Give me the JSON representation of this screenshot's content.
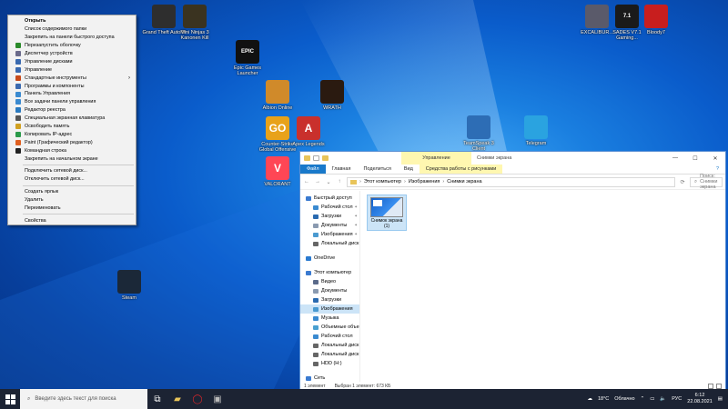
{
  "desktop_icons": [
    {
      "label": "Grand Theft Auto V",
      "icon": "gta-icon",
      "color": "#2e2e2e"
    },
    {
      "label": "Mini Ninjas 3 Kanonen Kill",
      "icon": "game-icon",
      "color": "#3a3320"
    },
    {
      "label": "Epic Games Launcher",
      "icon": "epic-icon",
      "color": "#111111",
      "glyph": "EPIC"
    },
    {
      "label": "Albion Online",
      "icon": "albion-icon",
      "color": "#d08a2a"
    },
    {
      "label": "WRATH",
      "icon": "wrath-icon",
      "color": "#2a1a10"
    },
    {
      "label": "Counter-Strike Global Offensive",
      "icon": "csgo-icon",
      "color": "#e8a21a",
      "glyph": "GO"
    },
    {
      "label": "Apex Legends",
      "icon": "apex-icon",
      "color": "#c9302c",
      "glyph": "A"
    },
    {
      "label": "VALORANT",
      "icon": "valorant-icon",
      "color": "#ff4655",
      "glyph": "V"
    },
    {
      "label": "TeamSpeak 3 Client",
      "icon": "teamspeak-icon",
      "color": "#2d6db5"
    },
    {
      "label": "Telegram",
      "icon": "telegram-icon",
      "color": "#2aa3e0"
    },
    {
      "label": "EXCALIBUR...",
      "icon": "excalibur-icon",
      "color": "#5a5a6a"
    },
    {
      "label": "SADES V7.1 Gaming...",
      "icon": "sades-icon",
      "color": "#1a1a1a",
      "glyph": "7.1"
    },
    {
      "label": "Bloody7",
      "icon": "bloody-icon",
      "color": "#c81e1e"
    },
    {
      "label": "Steam",
      "icon": "steam-icon",
      "color": "#1b2838"
    }
  ],
  "context_menu": {
    "items": [
      {
        "label": "Открыть",
        "bold": true,
        "color": ""
      },
      {
        "label": "Список содержимого папки",
        "color": ""
      },
      {
        "label": "Закрепить на панели быстрого доступа",
        "color": ""
      },
      {
        "label": "Перезапустить оболочку",
        "color": "#2a8a2a"
      },
      {
        "label": "Диспетчер устройств",
        "color": "#6a6a8a"
      },
      {
        "label": "Управление дисками",
        "color": "#3a6ab0"
      },
      {
        "label": "Управление",
        "color": "#3a6ab0"
      },
      {
        "label": "Стандартные инструменты",
        "color": "#c84a1a",
        "submenu": true
      },
      {
        "label": "Программы и компоненты",
        "color": "#3a6ab0"
      },
      {
        "label": "Панель Управления",
        "color": "#3a8ad0"
      },
      {
        "label": "Все задачи панели управления",
        "color": "#3a8ad0"
      },
      {
        "label": "Редактор реестра",
        "color": "#2a7ac0"
      },
      {
        "label": "Специальная экранная клавиатура",
        "color": "#555555"
      },
      {
        "label": "Освободить память",
        "color": "#d0a020"
      },
      {
        "label": "Копировать IP-адрес",
        "color": "#2a9a4a"
      },
      {
        "label": "Paint (Графический редактор)",
        "color": "#e06020"
      },
      {
        "label": "Командная строка",
        "color": "#222222"
      },
      {
        "label": "Закрепить на начальном экране",
        "color": ""
      },
      {
        "sep": true
      },
      {
        "label": "Подключить сетевой диск...",
        "color": ""
      },
      {
        "label": "Отключить сетевой диск...",
        "color": ""
      },
      {
        "sep": true
      },
      {
        "label": "Создать ярлык",
        "color": ""
      },
      {
        "label": "Удалить",
        "color": ""
      },
      {
        "label": "Переименовать",
        "color": ""
      },
      {
        "sep": true
      },
      {
        "label": "Свойства",
        "color": ""
      }
    ]
  },
  "explorer": {
    "context_tab_header": "Управление",
    "window_title": "Снимки экрана",
    "ribbon_tabs": [
      "Файл",
      "Главная",
      "Поделиться",
      "Вид",
      "Средства работы с рисунками"
    ],
    "address": [
      "Этот компьютер",
      "Изображения",
      "Снимки экрана"
    ],
    "search_placeholder": "Поиск: Снимки экрана",
    "nav": [
      {
        "label": "Быстрый доступ",
        "icon": "star-icon",
        "color": "#3a7ad0",
        "indent": 0
      },
      {
        "label": "Рабочий стол",
        "icon": "desktop-icon",
        "color": "#3a8ad0",
        "indent": 1,
        "pin": true
      },
      {
        "label": "Загрузки",
        "icon": "download-icon",
        "color": "#2a6ab0",
        "indent": 1,
        "pin": true
      },
      {
        "label": "Документы",
        "icon": "documents-icon",
        "color": "#8a9ab0",
        "indent": 1,
        "pin": true
      },
      {
        "label": "Изображения",
        "icon": "pictures-icon",
        "color": "#4a9ad0",
        "indent": 1,
        "pin": true
      },
      {
        "label": "Локальный диск (Z",
        "icon": "drive-icon",
        "color": "#666666",
        "indent": 1
      },
      {
        "gap": true
      },
      {
        "label": "OneDrive",
        "icon": "onedrive-icon",
        "color": "#2a7ad0",
        "indent": 0
      },
      {
        "gap": true
      },
      {
        "label": "Этот компьютер",
        "icon": "computer-icon",
        "color": "#3a7ad0",
        "indent": 0
      },
      {
        "label": "Видео",
        "icon": "video-icon",
        "color": "#5a6a8a",
        "indent": 1
      },
      {
        "label": "Документы",
        "icon": "documents-icon",
        "color": "#8a9ab0",
        "indent": 1
      },
      {
        "label": "Загрузки",
        "icon": "download-icon",
        "color": "#2a6ab0",
        "indent": 1
      },
      {
        "label": "Изображения",
        "icon": "pictures-icon",
        "color": "#4a9ad0",
        "indent": 1,
        "selected": true
      },
      {
        "label": "Музыка",
        "icon": "music-icon",
        "color": "#3a8ad0",
        "indent": 1
      },
      {
        "label": "Объемные объект",
        "icon": "3d-objects-icon",
        "color": "#4aa0d0",
        "indent": 1
      },
      {
        "label": "Рабочий стол",
        "icon": "desktop-icon",
        "color": "#3a8ad0",
        "indent": 1
      },
      {
        "label": "Локальный диск (С",
        "icon": "drive-icon",
        "color": "#666666",
        "indent": 1
      },
      {
        "label": "Локальный диск (D",
        "icon": "drive-icon",
        "color": "#666666",
        "indent": 1
      },
      {
        "label": "HDD (H:)",
        "icon": "drive-icon",
        "color": "#666666",
        "indent": 1
      },
      {
        "gap": true
      },
      {
        "label": "Сеть",
        "icon": "network-icon",
        "color": "#3a7ad0",
        "indent": 0
      }
    ],
    "file": {
      "name": "Снимок экрана",
      "index": "(1)"
    },
    "status": {
      "count": "1 элемент",
      "selected": "Выбран 1 элемент: 673 КБ"
    }
  },
  "taskbar": {
    "search_placeholder": "Введите здесь текст для поиска",
    "apps": [
      "task-view-icon",
      "file-explorer-icon",
      "opera-icon",
      "app-icon"
    ],
    "tray": {
      "weather": "18°C",
      "weather_desc": "Облачно",
      "lang": "РУС",
      "time": "6:12",
      "date": "22.08.2021"
    }
  }
}
